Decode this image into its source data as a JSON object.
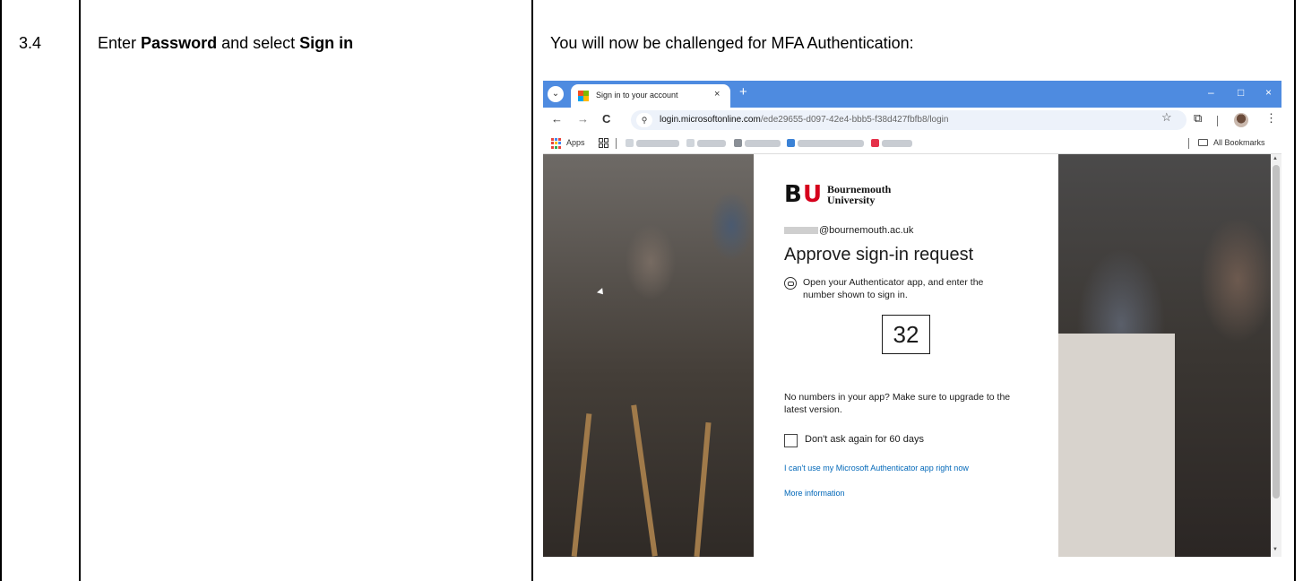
{
  "step": {
    "number": "3.4",
    "instruction_prefix": "Enter ",
    "instruction_bold1": "Password",
    "instruction_middle": " and select ",
    "instruction_bold2": "Sign in",
    "result_text": "You will now be challenged for MFA Authentication:"
  },
  "browser": {
    "tab_title": "Sign in to your account",
    "tab_close": "×",
    "new_tab": "+",
    "window_controls": [
      "–",
      "□",
      "×"
    ],
    "nav": {
      "back": "←",
      "forward": "→",
      "reload": "C"
    },
    "url_domain": "login.microsoftonline.com",
    "url_path": "/ede29655-d097-42e4-bbb5-f38d427fbfb8/login",
    "star_icon": "☆",
    "extensions_icon": "⧉",
    "menu_icon": "⋮",
    "bookmarks": {
      "apps_label": "Apps",
      "all_bookmarks_label": "All Bookmarks"
    }
  },
  "signin": {
    "logo_text_line1": "Bournemouth",
    "logo_text_line2": "University",
    "email_suffix": "@bournemouth.ac.uk",
    "heading": "Approve sign-in request",
    "instruction": "Open your Authenticator app, and enter the number shown to sign in.",
    "number": "32",
    "upgrade_note": "No numbers in your app? Make sure to upgrade to the latest version.",
    "checkbox_label": "Don't ask again for 60 days",
    "cant_use_link": "I can't use my Microsoft Authenticator app right now",
    "more_info_link": "More information"
  },
  "colors": {
    "tab_bar": "#4e8be0",
    "link": "#0067b8",
    "bu_red": "#d6001c"
  }
}
